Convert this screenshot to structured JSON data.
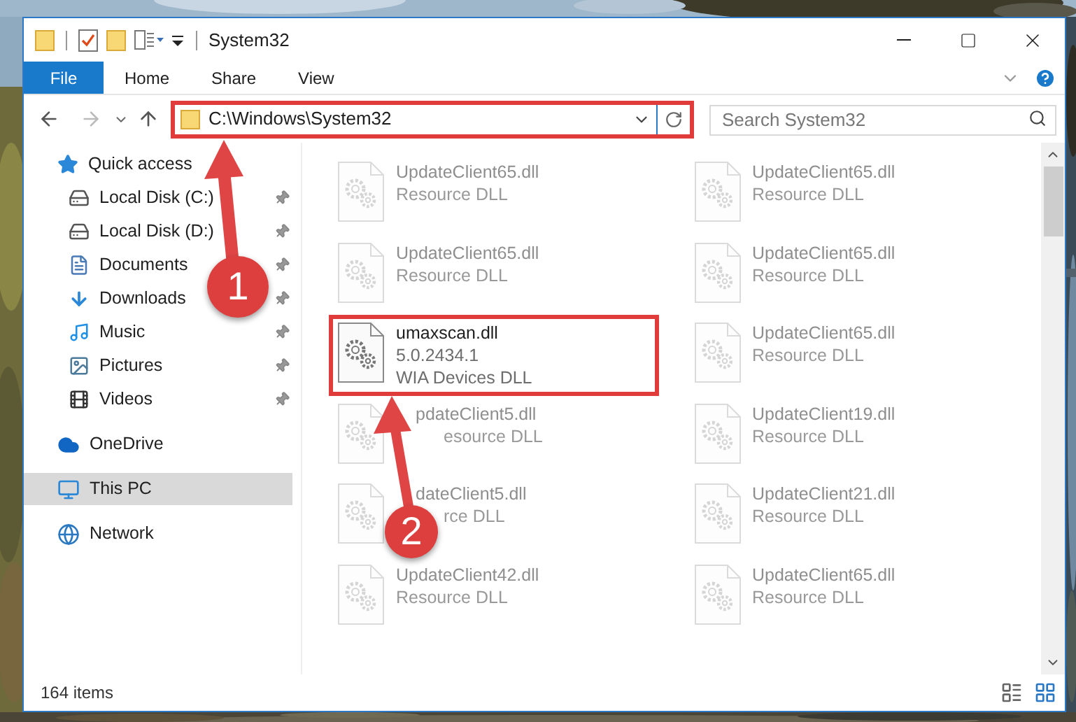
{
  "window": {
    "title": "System32"
  },
  "ribbon_tabs": [
    {
      "label": "File",
      "selected": true
    },
    {
      "label": "Home",
      "selected": false
    },
    {
      "label": "Share",
      "selected": false
    },
    {
      "label": "View",
      "selected": false
    }
  ],
  "address_bar": {
    "path": "C:\\Windows\\System32",
    "highlighted": true
  },
  "search": {
    "placeholder": "Search System32"
  },
  "navigation": [
    {
      "label": "Quick access",
      "kind": "star",
      "selected": false,
      "children": [
        {
          "label": "Local Disk (C:)",
          "kind": "drive",
          "pinned": true
        },
        {
          "label": "Local Disk (D:)",
          "kind": "drive",
          "pinned": true
        },
        {
          "label": "Documents",
          "kind": "documents",
          "pinned": true
        },
        {
          "label": "Downloads",
          "kind": "downloads",
          "pinned": true
        },
        {
          "label": "Music",
          "kind": "music",
          "pinned": true
        },
        {
          "label": "Pictures",
          "kind": "pictures",
          "pinned": true
        },
        {
          "label": "Videos",
          "kind": "videos",
          "pinned": true
        }
      ]
    },
    {
      "label": "OneDrive",
      "kind": "cloud",
      "selected": false
    },
    {
      "label": "This PC",
      "kind": "pc",
      "selected": true
    },
    {
      "label": "Network",
      "kind": "network",
      "selected": false
    }
  ],
  "files": [
    {
      "name": "UpdateClient65.dll",
      "details": [
        "Resource DLL"
      ],
      "dimmed": true,
      "highlighted": false
    },
    {
      "name": "UpdateClient65.dll",
      "details": [
        "Resource DLL"
      ],
      "dimmed": true,
      "highlighted": false
    },
    {
      "name": "UpdateClient65.dll",
      "details": [
        "Resource DLL"
      ],
      "dimmed": true,
      "highlighted": false
    },
    {
      "name": "UpdateClient65.dll",
      "details": [
        "Resource DLL"
      ],
      "dimmed": true,
      "highlighted": false
    },
    {
      "name": "umaxscan.dll",
      "details": [
        "5.0.2434.1",
        "WIA Devices DLL"
      ],
      "dimmed": false,
      "highlighted": true
    },
    {
      "name": "UpdateClient65.dll",
      "details": [
        "Resource DLL"
      ],
      "dimmed": true,
      "highlighted": false
    },
    {
      "name": "pdateClient5.dll",
      "details": [
        "esource DLL"
      ],
      "dimmed": true,
      "highlighted": false,
      "covered": true
    },
    {
      "name": "UpdateClient19.dll",
      "details": [
        "Resource DLL"
      ],
      "dimmed": true,
      "highlighted": false
    },
    {
      "name": "dateClient5.dll",
      "details": [
        "rce DLL"
      ],
      "dimmed": true,
      "highlighted": false,
      "covered": true
    },
    {
      "name": "UpdateClient21.dll",
      "details": [
        "Resource DLL"
      ],
      "dimmed": true,
      "highlighted": false
    },
    {
      "name": "UpdateClient42.dll",
      "details": [
        "Resource DLL"
      ],
      "dimmed": true,
      "highlighted": false
    },
    {
      "name": "UpdateClient65.dll",
      "details": [
        "Resource DLL"
      ],
      "dimmed": true,
      "highlighted": false
    }
  ],
  "annotations": [
    {
      "label": "1"
    },
    {
      "label": "2"
    }
  ],
  "status_bar": {
    "item_count": "164 items"
  }
}
